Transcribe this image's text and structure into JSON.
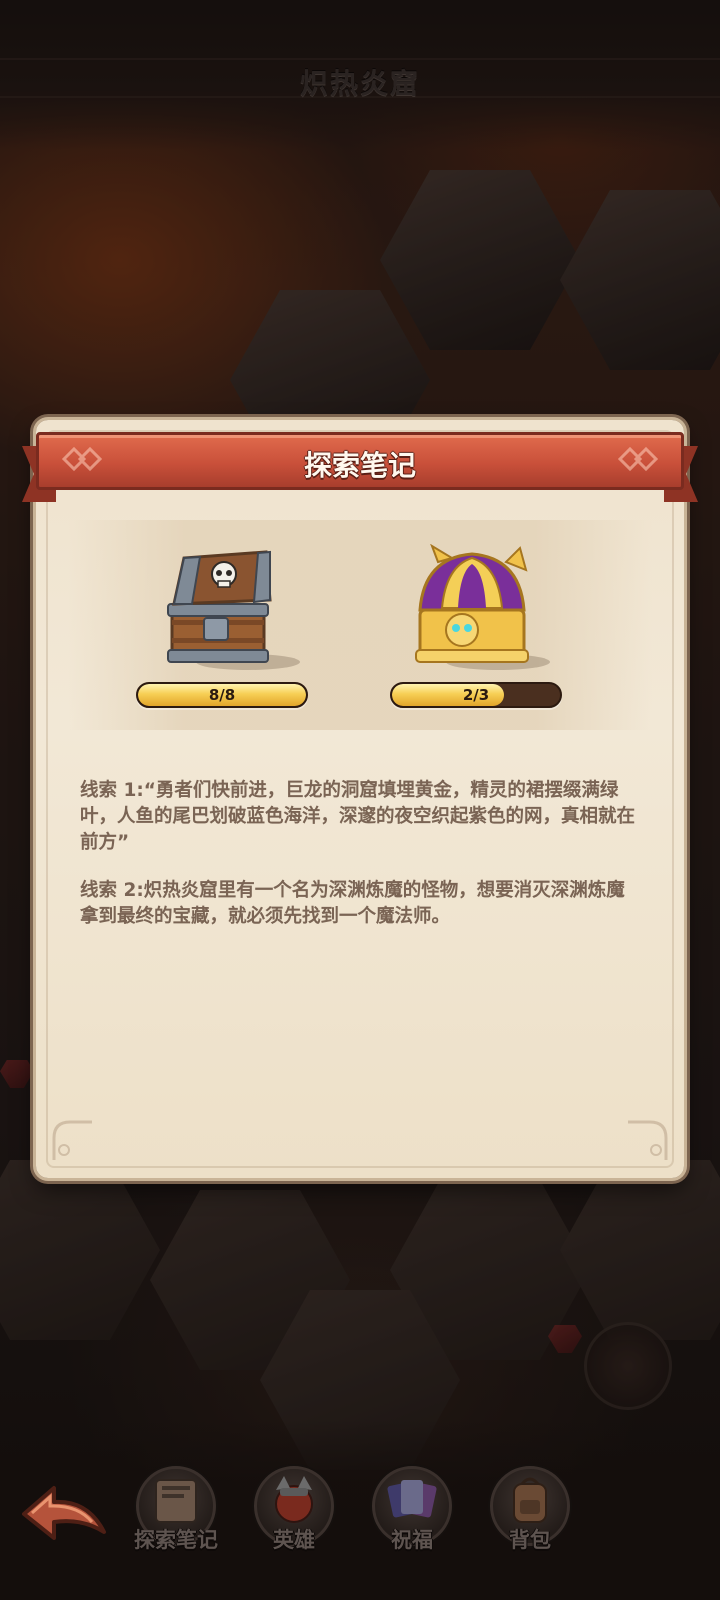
{
  "area": {
    "title": "炽热炎窟"
  },
  "dialog": {
    "title": "探索笔记",
    "rewards": [
      {
        "name": "iron-skull-chest",
        "progress_label": "8/8",
        "progress": 1.0
      },
      {
        "name": "golden-purple-chest",
        "progress_label": "2/3",
        "progress": 0.667
      }
    ],
    "clues": [
      "线索 1:“勇者们快前进，巨龙的洞窟填埋黄金，精灵的裙摆缀满绿叶，人鱼的尾巴划破蓝色海洋，深邃的夜空织起紫色的网，真相就在前方”",
      "线索 2:炽热炎窟里有一个名为深渊炼魔的怪物，想要消灭深渊炼魔拿到最终的宝藏，就必须先找到一个魔法师。"
    ]
  },
  "nav": {
    "back_icon": "back-arrow-icon",
    "items": [
      {
        "label": "探索笔记",
        "icon": "notebook-icon"
      },
      {
        "label": "英雄",
        "icon": "hero-icon"
      },
      {
        "label": "祝福",
        "icon": "blessing-cards-icon"
      },
      {
        "label": "背包",
        "icon": "backpack-icon"
      }
    ]
  },
  "colors": {
    "ribbon": "#c9503a",
    "parchment": "#f2e8d6",
    "clue_text": "#7a6454",
    "progress_fill": "#f7cf55"
  }
}
